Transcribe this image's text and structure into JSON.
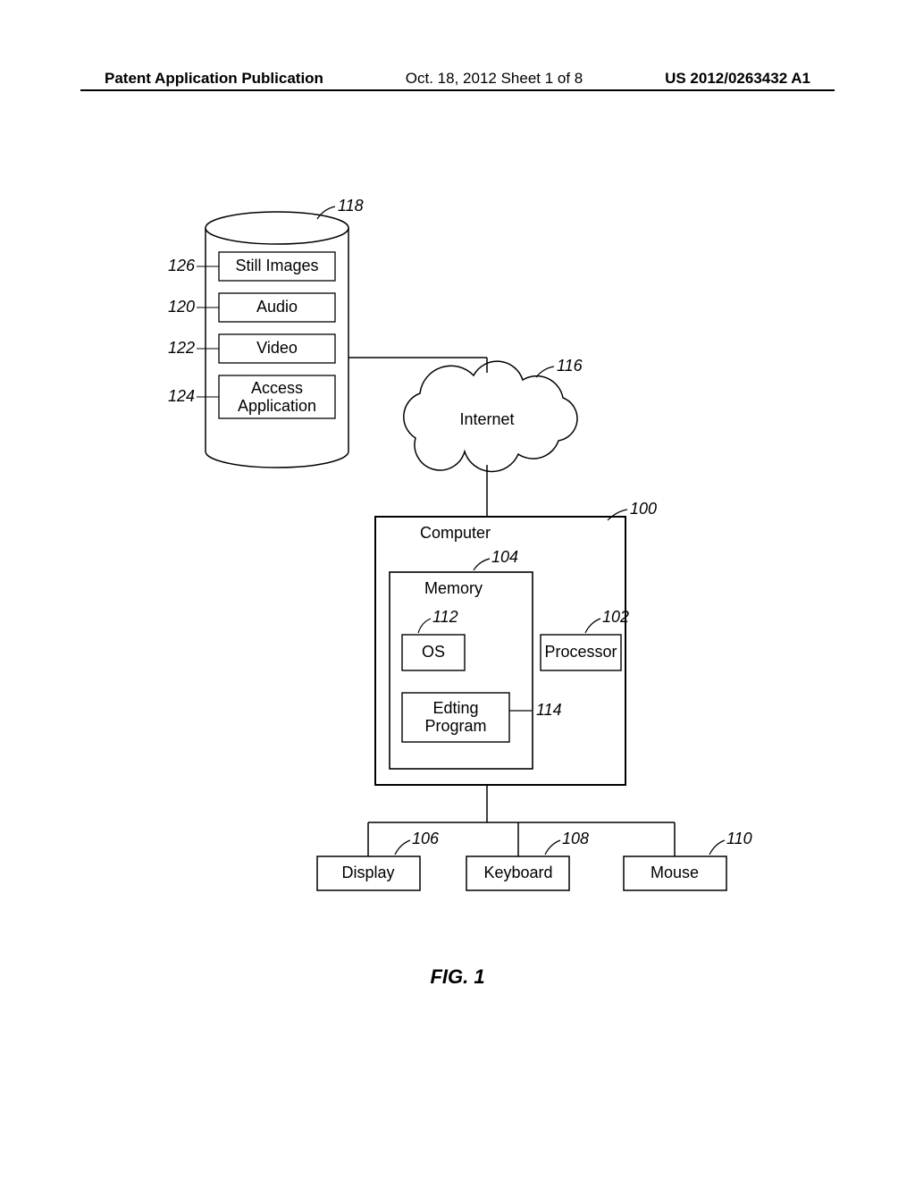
{
  "header": {
    "left": "Patent Application Publication",
    "mid": "Oct. 18, 2012  Sheet 1 of 8",
    "right": "US 2012/0263432 A1"
  },
  "figure_label": "FIG. 1",
  "refs": {
    "118": "118",
    "126": "126",
    "120": "120",
    "122": "122",
    "124": "124",
    "116": "116",
    "100": "100",
    "104": "104",
    "112": "112",
    "102": "102",
    "114": "114",
    "106": "106",
    "108": "108",
    "110": "110"
  },
  "labels": {
    "still_images": "Still Images",
    "audio": "Audio",
    "video": "Video",
    "access_application_l1": "Access",
    "access_application_l2": "Application",
    "internet": "Internet",
    "computer": "Computer",
    "memory": "Memory",
    "os": "OS",
    "processor": "Processor",
    "editing_l1": "Edting",
    "editing_l2": "Program",
    "display": "Display",
    "keyboard": "Keyboard",
    "mouse": "Mouse"
  }
}
